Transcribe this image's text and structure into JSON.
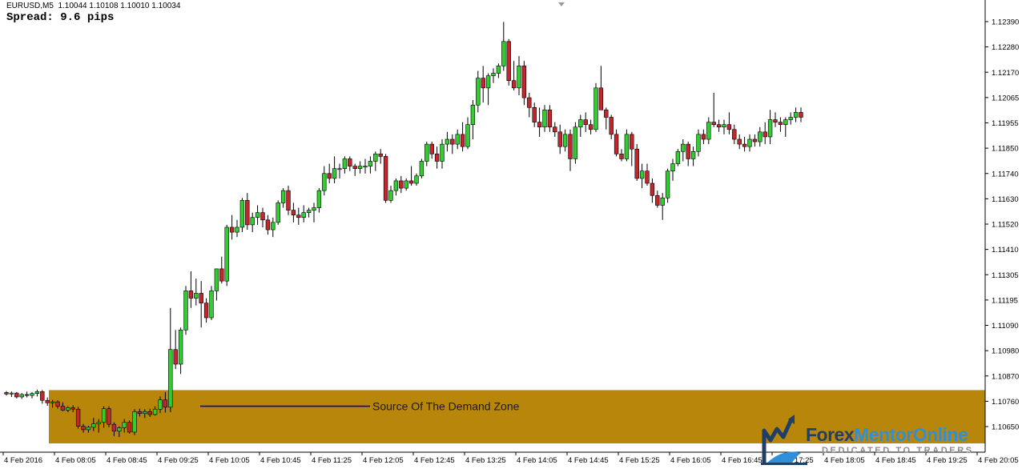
{
  "header": {
    "symbol_line": "EURUSD,M5  1.10044 1.10108 1.10010 1.10034",
    "spread_line": "Spread: 9.6 pips"
  },
  "annotation": {
    "label": "Source Of The Demand Zone",
    "zone_top_price": 1.10874,
    "zone_bottom_price": 1.10656,
    "zone_color": "#b8860b",
    "line_color": "#0000cd"
  },
  "watermark": {
    "brand_part1": "Forex",
    "brand_part2": "MentorOnline",
    "tagline": "DEDICATED TO TRADERS",
    "icon": "bull-head-chart-icon"
  },
  "colors": {
    "bull": "#32cd32",
    "bear": "#c1272d",
    "wick": "#000000",
    "background": "#ffffff",
    "axis": "#000000"
  },
  "chart_data": {
    "type": "candlestick",
    "symbol": "EURUSD",
    "timeframe": "M5",
    "y_ticks": [
      "1.12390",
      "1.12280",
      "1.12170",
      "1.12065",
      "1.11955",
      "1.11850",
      "1.11740",
      "1.11630",
      "1.11520",
      "1.11410",
      "1.11305",
      "1.11195",
      "1.11090",
      "1.10980",
      "1.10870",
      "1.10760",
      "1.10650"
    ],
    "x_ticks": [
      "4 Feb 2016",
      "4 Feb 08:05",
      "4 Feb 08:45",
      "4 Feb 09:25",
      "4 Feb 10:05",
      "4 Feb 10:45",
      "4 Feb 11:25",
      "4 Feb 12:05",
      "4 Feb 12:45",
      "4 Feb 13:25",
      "4 Feb 14:05",
      "4 Feb 14:45",
      "4 Feb 15:25",
      "4 Feb 16:05",
      "4 Feb 16:45",
      "4 Feb 17:25",
      "4 Feb 18:05",
      "4 Feb 18:45",
      "4 Feb 19:25",
      "4 Feb 20:05"
    ],
    "ylim": [
      1.1062,
      1.1245
    ],
    "candles": [
      [
        1.10864,
        1.1087,
        1.10852,
        1.10858
      ],
      [
        1.10858,
        1.10868,
        1.10846,
        1.10862
      ],
      [
        1.10862,
        1.10866,
        1.1084,
        1.10846
      ],
      [
        1.10846,
        1.10862,
        1.10838,
        1.10856
      ],
      [
        1.10856,
        1.10868,
        1.10844,
        1.10852
      ],
      [
        1.10852,
        1.10866,
        1.1084,
        1.1086
      ],
      [
        1.1086,
        1.10876,
        1.10848,
        1.10868
      ],
      [
        1.10868,
        1.10874,
        1.10818,
        1.10832
      ],
      [
        1.10832,
        1.10844,
        1.1081,
        1.10822
      ],
      [
        1.10822,
        1.10834,
        1.10802,
        1.10826
      ],
      [
        1.10826,
        1.10832,
        1.10798,
        1.10808
      ],
      [
        1.10808,
        1.10824,
        1.10788,
        1.10792
      ],
      [
        1.10792,
        1.10808,
        1.10784,
        1.10802
      ],
      [
        1.10802,
        1.10812,
        1.10784,
        1.10796
      ],
      [
        1.10796,
        1.10806,
        1.10716,
        1.10726
      ],
      [
        1.10726,
        1.10736,
        1.107,
        1.10712
      ],
      [
        1.10712,
        1.10728,
        1.107,
        1.10722
      ],
      [
        1.10722,
        1.1076,
        1.10706,
        1.10736
      ],
      [
        1.10736,
        1.10756,
        1.107,
        1.10742
      ],
      [
        1.10742,
        1.10808,
        1.1072,
        1.10798
      ],
      [
        1.10798,
        1.10808,
        1.10722,
        1.10734
      ],
      [
        1.10734,
        1.10742,
        1.10686,
        1.10706
      ],
      [
        1.10706,
        1.10726,
        1.10682,
        1.1072
      ],
      [
        1.1072,
        1.10756,
        1.107,
        1.10742
      ],
      [
        1.10742,
        1.1075,
        1.10696,
        1.10702
      ],
      [
        1.10702,
        1.10796,
        1.1069,
        1.10786
      ],
      [
        1.10786,
        1.10798,
        1.10766,
        1.10778
      ],
      [
        1.10778,
        1.10796,
        1.1076,
        1.10786
      ],
      [
        1.10786,
        1.10798,
        1.10764,
        1.10774
      ],
      [
        1.10774,
        1.10808,
        1.1077,
        1.10796
      ],
      [
        1.10796,
        1.10848,
        1.1078,
        1.10834
      ],
      [
        1.10834,
        1.10866,
        1.10782,
        1.10804
      ],
      [
        1.10804,
        1.1121,
        1.10784,
        1.1104
      ],
      [
        1.1104,
        1.1112,
        1.1096,
        1.1098
      ],
      [
        1.1098,
        1.1113,
        1.1094,
        1.1112
      ],
      [
        1.1112,
        1.113,
        1.111,
        1.1128
      ],
      [
        1.1128,
        1.1136,
        1.1121,
        1.1125
      ],
      [
        1.1125,
        1.1133,
        1.1122,
        1.1127
      ],
      [
        1.1127,
        1.1132,
        1.1113,
        1.1123
      ],
      [
        1.1123,
        1.1125,
        1.1115,
        1.1117
      ],
      [
        1.1117,
        1.113,
        1.1116,
        1.1128
      ],
      [
        1.1128,
        1.1136,
        1.1124,
        1.1137
      ],
      [
        1.1137,
        1.1142,
        1.1131,
        1.1132
      ],
      [
        1.1132,
        1.1155,
        1.113,
        1.1154
      ],
      [
        1.1154,
        1.1159,
        1.1149,
        1.1152
      ],
      [
        1.1152,
        1.1157,
        1.115,
        1.1154
      ],
      [
        1.1154,
        1.1166,
        1.1152,
        1.1165
      ],
      [
        1.1165,
        1.1168,
        1.1153,
        1.1155
      ],
      [
        1.1155,
        1.116,
        1.1152,
        1.1158
      ],
      [
        1.1158,
        1.1163,
        1.1155,
        1.116
      ],
      [
        1.116,
        1.1162,
        1.1154,
        1.1157
      ],
      [
        1.1157,
        1.1159,
        1.1151,
        1.1153
      ],
      [
        1.1153,
        1.1158,
        1.115,
        1.1156
      ],
      [
        1.1156,
        1.1165,
        1.1155,
        1.1164
      ],
      [
        1.1164,
        1.117,
        1.1162,
        1.1169
      ],
      [
        1.1169,
        1.1171,
        1.1159,
        1.1161
      ],
      [
        1.1161,
        1.1164,
        1.1156,
        1.1159
      ],
      [
        1.1159,
        1.1162,
        1.1155,
        1.1158
      ],
      [
        1.1158,
        1.1163,
        1.1156,
        1.116
      ],
      [
        1.116,
        1.1162,
        1.1158,
        1.1161
      ],
      [
        1.1161,
        1.1164,
        1.1156,
        1.1162
      ],
      [
        1.1162,
        1.117,
        1.116,
        1.1169
      ],
      [
        1.1169,
        1.1179,
        1.1167,
        1.1176
      ],
      [
        1.1176,
        1.118,
        1.1172,
        1.1174
      ],
      [
        1.1174,
        1.1183,
        1.1172,
        1.1178
      ],
      [
        1.1178,
        1.118,
        1.1174,
        1.1178
      ],
      [
        1.1178,
        1.1183,
        1.1176,
        1.1182
      ],
      [
        1.1182,
        1.1183,
        1.1177,
        1.1179
      ],
      [
        1.1179,
        1.118,
        1.1175,
        1.1178
      ],
      [
        1.1178,
        1.1181,
        1.1176,
        1.1179
      ],
      [
        1.1179,
        1.1182,
        1.1176,
        1.1179
      ],
      [
        1.1179,
        1.1183,
        1.1176,
        1.1181
      ],
      [
        1.1181,
        1.1185,
        1.1177,
        1.1184
      ],
      [
        1.1184,
        1.1186,
        1.118,
        1.1183
      ],
      [
        1.1183,
        1.1184,
        1.1164,
        1.1165
      ],
      [
        1.1165,
        1.1171,
        1.1164,
        1.1169
      ],
      [
        1.1169,
        1.1174,
        1.1167,
        1.1173
      ],
      [
        1.1173,
        1.1175,
        1.1168,
        1.117
      ],
      [
        1.117,
        1.1174,
        1.1169,
        1.1173
      ],
      [
        1.1173,
        1.1179,
        1.1171,
        1.1172
      ],
      [
        1.1172,
        1.1176,
        1.1171,
        1.1175
      ],
      [
        1.1175,
        1.1182,
        1.1174,
        1.1181
      ],
      [
        1.1181,
        1.1189,
        1.1179,
        1.1188
      ],
      [
        1.1188,
        1.1189,
        1.1182,
        1.1184
      ],
      [
        1.1184,
        1.1187,
        1.1178,
        1.1181
      ],
      [
        1.1181,
        1.119,
        1.1178,
        1.1188
      ],
      [
        1.1188,
        1.1193,
        1.1185,
        1.119
      ],
      [
        1.119,
        1.1192,
        1.1184,
        1.1188
      ],
      [
        1.1188,
        1.1194,
        1.1186,
        1.1192
      ],
      [
        1.1192,
        1.1197,
        1.1185,
        1.1187
      ],
      [
        1.1187,
        1.1199,
        1.1186,
        1.1196
      ],
      [
        1.1196,
        1.1206,
        1.119,
        1.1204
      ],
      [
        1.1204,
        1.1218,
        1.1201,
        1.1215
      ],
      [
        1.1215,
        1.122,
        1.1205,
        1.1211
      ],
      [
        1.1211,
        1.1217,
        1.1204,
        1.1216
      ],
      [
        1.1216,
        1.1219,
        1.1213,
        1.1217
      ],
      [
        1.1217,
        1.1221,
        1.1215,
        1.122
      ],
      [
        1.122,
        1.1238,
        1.1218,
        1.123
      ],
      [
        1.123,
        1.1231,
        1.1212,
        1.1214
      ],
      [
        1.1214,
        1.1222,
        1.121,
        1.1211
      ],
      [
        1.1211,
        1.1224,
        1.1208,
        1.122
      ],
      [
        1.122,
        1.1222,
        1.1204,
        1.1207
      ],
      [
        1.1207,
        1.1209,
        1.1199,
        1.1203
      ],
      [
        1.1203,
        1.1205,
        1.1195,
        1.1197
      ],
      [
        1.1197,
        1.1203,
        1.1191,
        1.1195
      ],
      [
        1.1195,
        1.1204,
        1.1193,
        1.1202
      ],
      [
        1.1202,
        1.1204,
        1.1193,
        1.1195
      ],
      [
        1.1195,
        1.1197,
        1.1191,
        1.1193
      ],
      [
        1.1193,
        1.1196,
        1.1184,
        1.1187
      ],
      [
        1.1187,
        1.1194,
        1.1185,
        1.1192
      ],
      [
        1.1192,
        1.1194,
        1.1177,
        1.1182
      ],
      [
        1.1182,
        1.1197,
        1.118,
        1.1195
      ],
      [
        1.1195,
        1.12,
        1.1191,
        1.1198
      ],
      [
        1.1198,
        1.1201,
        1.1193,
        1.1196
      ],
      [
        1.1196,
        1.1198,
        1.1192,
        1.1194
      ],
      [
        1.1194,
        1.1213,
        1.1193,
        1.1211
      ],
      [
        1.1211,
        1.122,
        1.1205,
        1.1202
      ],
      [
        1.1202,
        1.1203,
        1.1194,
        1.1199
      ],
      [
        1.1199,
        1.12,
        1.119,
        1.1192
      ],
      [
        1.1192,
        1.1194,
        1.1183,
        1.1184
      ],
      [
        1.1184,
        1.1186,
        1.1181,
        1.1182
      ],
      [
        1.1182,
        1.1194,
        1.1181,
        1.1192
      ],
      [
        1.1192,
        1.1193,
        1.1179,
        1.1186
      ],
      [
        1.1186,
        1.1188,
        1.1173,
        1.1174
      ],
      [
        1.1174,
        1.118,
        1.117,
        1.1177
      ],
      [
        1.1177,
        1.118,
        1.1171,
        1.1172
      ],
      [
        1.1172,
        1.1174,
        1.1164,
        1.1167
      ],
      [
        1.1167,
        1.1169,
        1.1162,
        1.1163
      ],
      [
        1.1163,
        1.1168,
        1.1157,
        1.1166
      ],
      [
        1.1166,
        1.1178,
        1.1164,
        1.1177
      ],
      [
        1.1177,
        1.1182,
        1.1173,
        1.118
      ],
      [
        1.118,
        1.1186,
        1.1179,
        1.1185
      ],
      [
        1.1185,
        1.119,
        1.1181,
        1.1188
      ],
      [
        1.1188,
        1.1189,
        1.1179,
        1.1182
      ],
      [
        1.1182,
        1.1187,
        1.1179,
        1.1185
      ],
      [
        1.1185,
        1.1194,
        1.1183,
        1.1192
      ],
      [
        1.1192,
        1.1194,
        1.1188,
        1.119
      ],
      [
        1.119,
        1.1199,
        1.1188,
        1.1197
      ],
      [
        1.1197,
        1.1209,
        1.1195,
        1.1196
      ],
      [
        1.1196,
        1.1198,
        1.1193,
        1.1195
      ],
      [
        1.1195,
        1.1198,
        1.1192,
        1.1196
      ],
      [
        1.1196,
        1.1201,
        1.1192,
        1.1194
      ],
      [
        1.1194,
        1.1196,
        1.1188,
        1.119
      ],
      [
        1.119,
        1.1192,
        1.1186,
        1.1188
      ],
      [
        1.1188,
        1.1191,
        1.1185,
        1.1187
      ],
      [
        1.1187,
        1.1192,
        1.1185,
        1.119
      ],
      [
        1.119,
        1.1192,
        1.1187,
        1.1189
      ],
      [
        1.1189,
        1.1195,
        1.1187,
        1.1193
      ],
      [
        1.1193,
        1.1197,
        1.1188,
        1.1191
      ],
      [
        1.1191,
        1.1202,
        1.1188,
        1.1198
      ],
      [
        1.1198,
        1.1201,
        1.1195,
        1.1197
      ],
      [
        1.1197,
        1.1199,
        1.1193,
        1.1196
      ],
      [
        1.1196,
        1.1199,
        1.1191,
        1.1198
      ],
      [
        1.1198,
        1.1201,
        1.1196,
        1.1199
      ],
      [
        1.1199,
        1.1203,
        1.1197,
        1.1201
      ],
      [
        1.1201,
        1.1203,
        1.1197,
        1.1199
      ]
    ]
  }
}
